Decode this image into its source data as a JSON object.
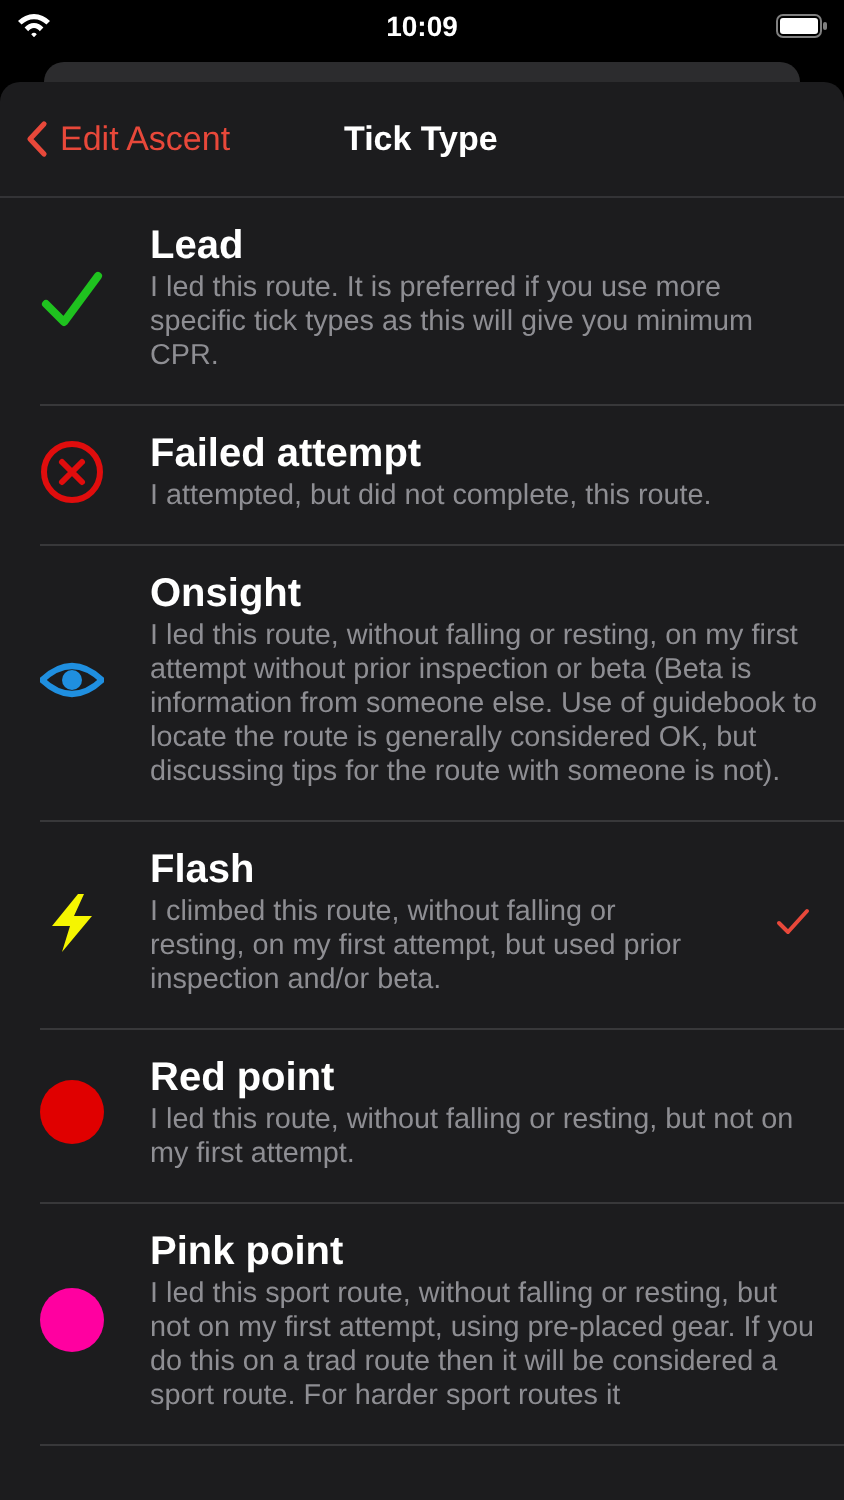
{
  "status_bar": {
    "time": "10:09"
  },
  "nav": {
    "back": "Edit Ascent",
    "title": "Tick Type"
  },
  "tick_types": [
    {
      "title": "Lead",
      "description": "I led this route. It is preferred if you use more specific tick types as this will give you minimum CPR.",
      "kind": "check",
      "color": "#1fc21f",
      "selected": false
    },
    {
      "title": "Failed attempt",
      "description": "I attempted, but did not complete, this route.",
      "kind": "cross",
      "color": "#e00d0d",
      "selected": false
    },
    {
      "title": "Onsight",
      "description": "I led this route, without falling or resting, on my first attempt without prior inspection or beta (Beta is information from someone else. Use of guidebook to locate the route is generally considered OK, but discussing tips for the route with someone is not).",
      "kind": "eye",
      "color": "#1f8fe0",
      "selected": false
    },
    {
      "title": "Flash",
      "description": "I climbed this route, without falling or resting, on my first attempt, but used prior inspection and/or beta.",
      "kind": "bolt",
      "color": "#f5f500",
      "selected": true
    },
    {
      "title": "Red point",
      "description": "I led this route, without falling or resting, but not on my first attempt.",
      "kind": "dot",
      "color": "#e00000",
      "selected": false
    },
    {
      "title": "Pink point",
      "description": "I led this sport route, without falling or resting, but not on my first attempt, using pre-placed gear. If you do this on a trad route then it will be considered a sport route. For harder sport routes it",
      "kind": "dot",
      "color": "#ff00a0",
      "selected": false
    }
  ]
}
